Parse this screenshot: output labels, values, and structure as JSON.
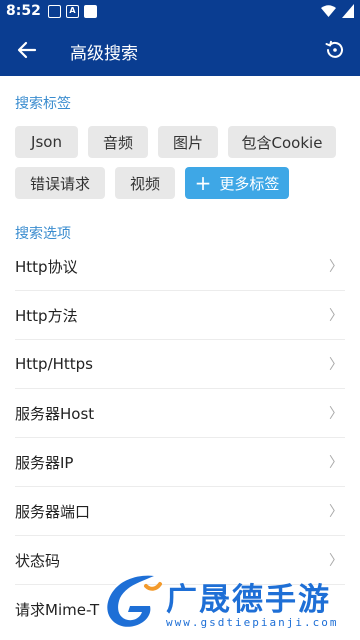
{
  "status_bar": {
    "time": "8:52",
    "notification_icons": [
      "square-icon",
      "a-icon",
      "square-filled-icon"
    ],
    "notification_text": "A",
    "right_icons": [
      "wifi-icon",
      "signal-icon"
    ]
  },
  "app_bar": {
    "title": "高级搜索",
    "back_icon": "arrow-left-icon",
    "history_icon": "history-icon",
    "background": "#0a3d91"
  },
  "tags_section": {
    "title": "搜索标签",
    "tags": [
      "Json",
      "音频",
      "图片",
      "包含Cookie",
      "错误请求",
      "视频"
    ],
    "more_button": "更多标签"
  },
  "options_section": {
    "title": "搜索选项",
    "items": [
      "Http协议",
      "Http方法",
      "Http/Https",
      "服务器Host",
      "服务器IP",
      "服务器端口",
      "状态码",
      "请求Mime-T"
    ]
  },
  "watermark": {
    "name": "广晟德手游",
    "url": "www.gsdtiepianji.com"
  },
  "colors": {
    "accent": "#3ea7e6",
    "section_title": "#3a8ccf",
    "chip_bg": "#e8e8e8"
  }
}
